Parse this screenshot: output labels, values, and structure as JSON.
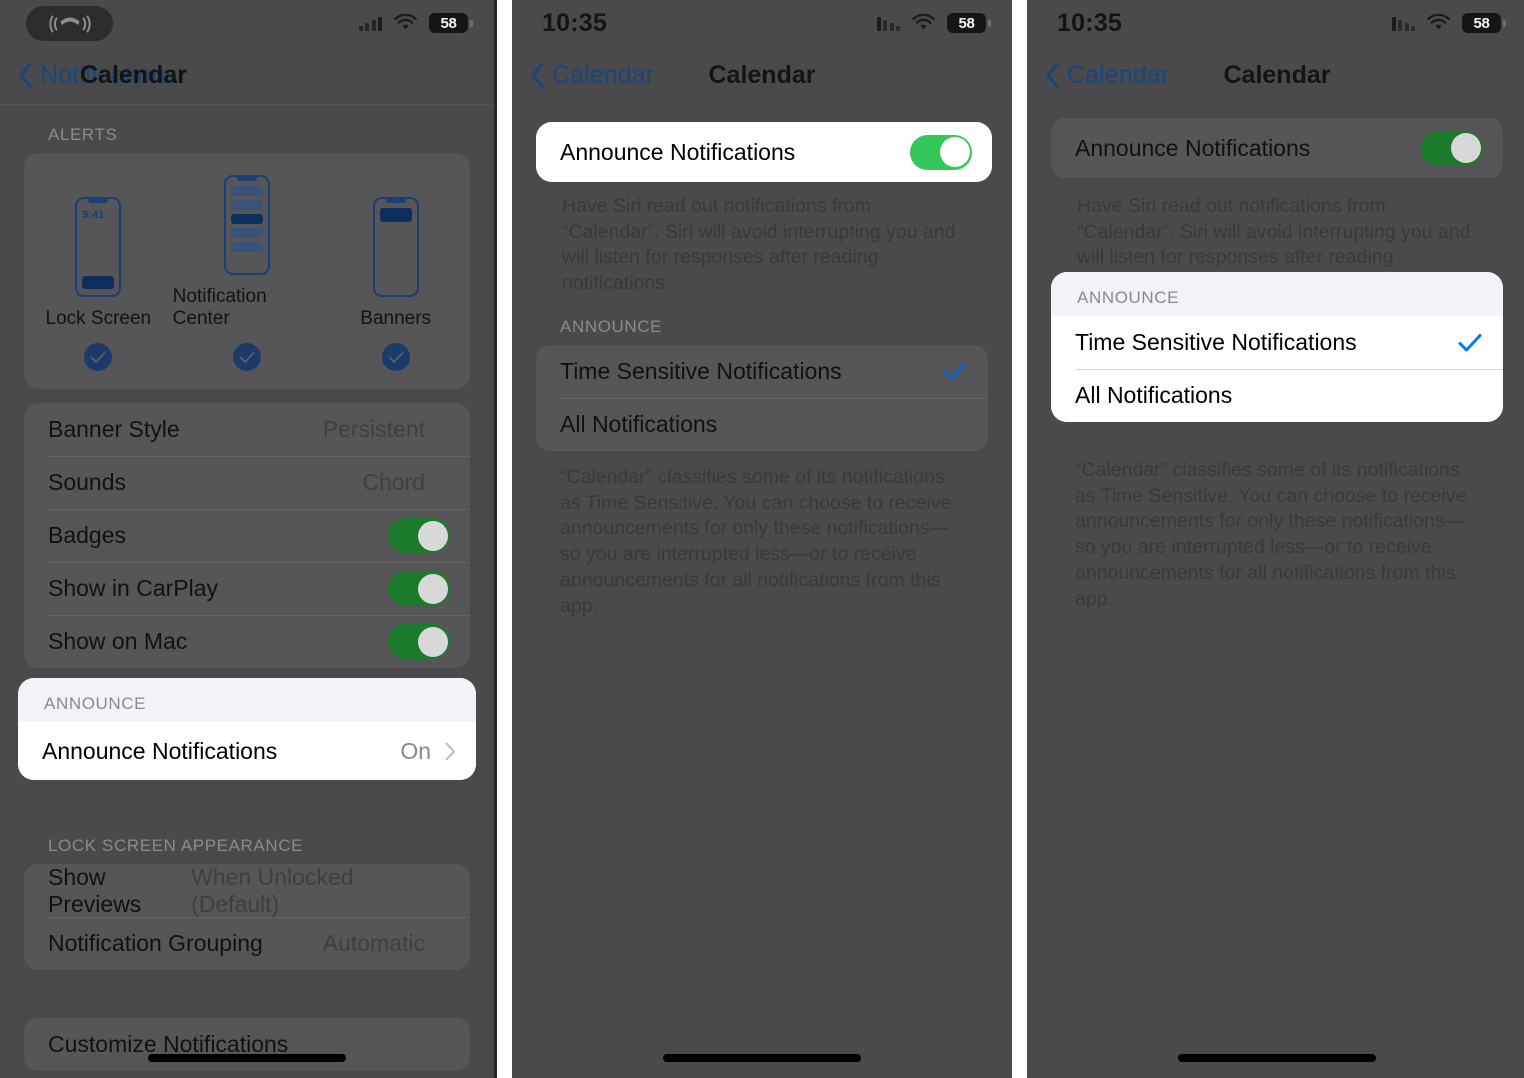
{
  "panels": [
    {
      "id": "panel-notifications-settings",
      "status": {
        "time": "",
        "island": "active-call",
        "battery": "58",
        "signal": "ascending",
        "wifi": "wifi-icon"
      },
      "nav": {
        "back": "Notifications",
        "title": "Calendar"
      },
      "alerts": {
        "header": "ALERTS",
        "items": [
          {
            "name": "Lock Screen",
            "time": "9:41",
            "checked": true
          },
          {
            "name": "Notification Center",
            "checked": true
          },
          {
            "name": "Banners",
            "checked": true
          }
        ]
      },
      "rows": [
        {
          "label": "Banner Style",
          "value": "Persistent",
          "type": "disclosure"
        },
        {
          "label": "Sounds",
          "value": "Chord",
          "type": "disclosure"
        },
        {
          "label": "Badges",
          "value": "On",
          "type": "toggle"
        },
        {
          "label": "Show in CarPlay",
          "value": "On",
          "type": "toggle"
        },
        {
          "label": "Show on Mac",
          "value": "On",
          "type": "toggle"
        }
      ],
      "announce": {
        "header": "ANNOUNCE",
        "row": {
          "label": "Announce Notifications",
          "value": "On"
        }
      },
      "lock_screen": {
        "header": "LOCK SCREEN APPEARANCE",
        "rows": [
          {
            "label": "Show Previews",
            "value": "When Unlocked (Default)"
          },
          {
            "label": "Notification Grouping",
            "value": "Automatic"
          }
        ]
      },
      "customize": {
        "label": "Customize Notifications"
      }
    },
    {
      "id": "panel-announce-toggle",
      "status": {
        "time": "10:35",
        "battery": "58",
        "signal": "descending",
        "wifi": "wifi-icon"
      },
      "nav": {
        "back": "Calendar",
        "title": "Calendar"
      },
      "toggle_row": {
        "label": "Announce Notifications",
        "value": "On"
      },
      "description": "Have Siri read out notifications from “Calendar”. Siri will avoid interrupting you and will listen for responses after reading notifications.",
      "announce": {
        "header": "ANNOUNCE",
        "options": [
          {
            "label": "Time Sensitive Notifications",
            "selected": true
          },
          {
            "label": "All Notifications",
            "selected": false
          }
        ]
      },
      "footer": "“Calendar” classifies some of its notifications as Time Sensitive. You can choose to receive announcements for only these notifications—so you are interrupted less—or to receive announcements for all notifications from this app."
    },
    {
      "id": "panel-announce-options",
      "status": {
        "time": "10:35",
        "battery": "58",
        "signal": "descending",
        "wifi": "wifi-icon"
      },
      "nav": {
        "back": "Calendar",
        "title": "Calendar"
      },
      "toggle_row": {
        "label": "Announce Notifications",
        "value": "On"
      },
      "description": "Have Siri read out notifications from “Calendar”. Siri will avoid interrupting you and will listen for responses after reading notifications.",
      "announce": {
        "header": "ANNOUNCE",
        "options": [
          {
            "label": "Time Sensitive Notifications",
            "selected": true
          },
          {
            "label": "All Notifications",
            "selected": false
          }
        ]
      },
      "footer": "“Calendar” classifies some of its notifications as Time Sensitive. You can choose to receive announcements for only these notifications—so you are interrupted less—or to receive announcements for all notifications from this app."
    }
  ],
  "colors": {
    "accent_blue": "#007AFF",
    "nav_blue": "#17467f",
    "toggle_green_dim": "#1b7a2c",
    "toggle_green_bright": "#34c759",
    "scrim": "#4a4a4c",
    "card_dim": "#565658",
    "highlight_white": "#ffffff",
    "group_header_bg": "#f2f2f7"
  }
}
